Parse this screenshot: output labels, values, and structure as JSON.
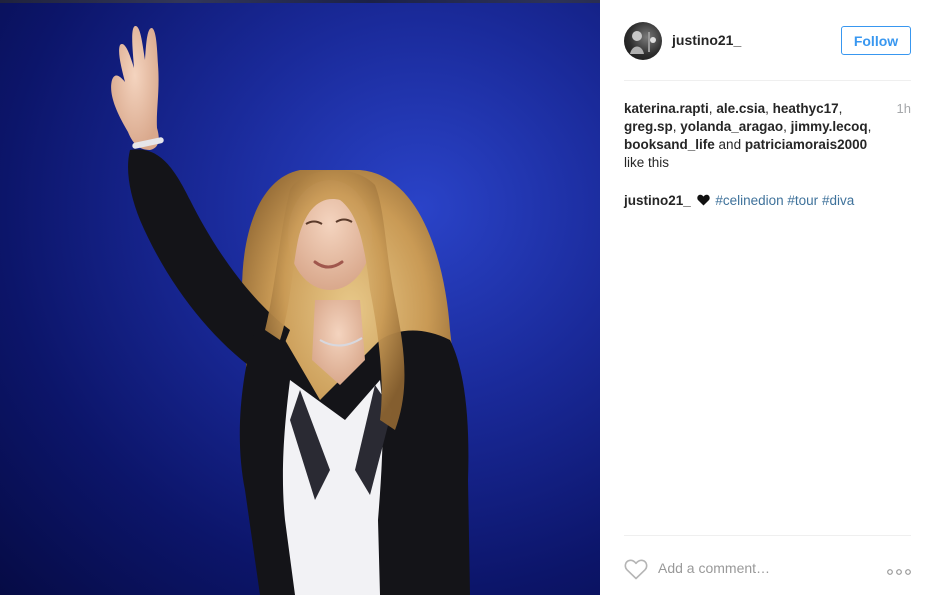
{
  "post": {
    "photo_icon": "performer-waving-photo",
    "author": {
      "username": "justino21_",
      "avatar_icon": "user-avatar"
    },
    "follow_label": "Follow",
    "timestamp": "1h",
    "likes": {
      "users": [
        "katerina.rapti",
        "ale.csia",
        "heathyc17",
        "greg.sp",
        "yolanda_aragao",
        "jimmy.lecoq",
        "booksand_life"
      ],
      "and_text": "and",
      "last_user": "patriciamorais2000",
      "suffix": "like this"
    },
    "caption": {
      "username": "justino21_",
      "heart_icon": "heart-icon",
      "hashtags": [
        "#celinedion",
        "#tour",
        "#diva"
      ]
    },
    "comment_placeholder": "Add a comment…",
    "icons": {
      "like": "heart-outline-icon",
      "more": "more-options-icon"
    },
    "colors": {
      "accent": "#3897f0",
      "hashtag": "#3f729b",
      "text": "#262626",
      "muted": "#a5a7aa"
    }
  }
}
